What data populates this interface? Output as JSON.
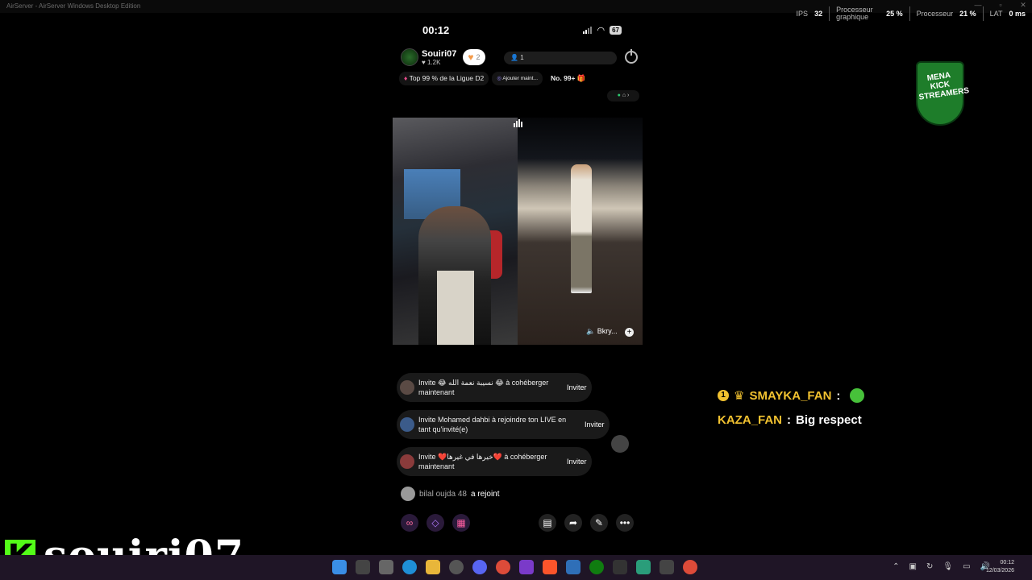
{
  "window": {
    "title": "AirServer - AirServer Windows Desktop Edition"
  },
  "stats": {
    "fps_label": "IPS",
    "fps_value": "32",
    "gpu_label": "Processeur graphique",
    "gpu_value": "25 %",
    "cpu_label": "Processeur",
    "cpu_value": "21 %",
    "lat_label": "LAT",
    "lat_value": "0 ms"
  },
  "phone": {
    "time": "00:12",
    "battery": "67",
    "host": {
      "name": "Souiri07",
      "likes": "1.2K",
      "follow_count": "2"
    },
    "viewers": "1",
    "chips": {
      "league": "Top 99 % de la Ligue D2",
      "add": "Ajouter maint...",
      "rank": "No. 99+"
    },
    "guest_name": "Bkry...",
    "invites": [
      {
        "text": "Invite 😂 نسيبة نعمة الله 😂 à cohéberger maintenant",
        "button": "Inviter"
      },
      {
        "text": "Invite Mohamed dahbi à rejoindre ton LIVE en tant qu'invité(e)",
        "button": "Inviter"
      },
      {
        "text": "Invite ❤️خيرها في غيرها❤️ à cohéberger maintenant",
        "button": "Inviter"
      }
    ],
    "joined": {
      "name": "bilal oujda 48",
      "action": "a rejoint"
    }
  },
  "logo": {
    "text": "MENA KICK STREAMERS"
  },
  "chat": [
    {
      "user": "SMAYKA_FAN",
      "sep": ":",
      "message": ""
    },
    {
      "user": "KAZA_FAN",
      "sep": ":",
      "message": "Big respect"
    }
  ],
  "streamer": {
    "kick_letter": "K",
    "name": "souiri07"
  },
  "taskbar": {
    "time": "00:12",
    "date": "12/03/2026"
  }
}
